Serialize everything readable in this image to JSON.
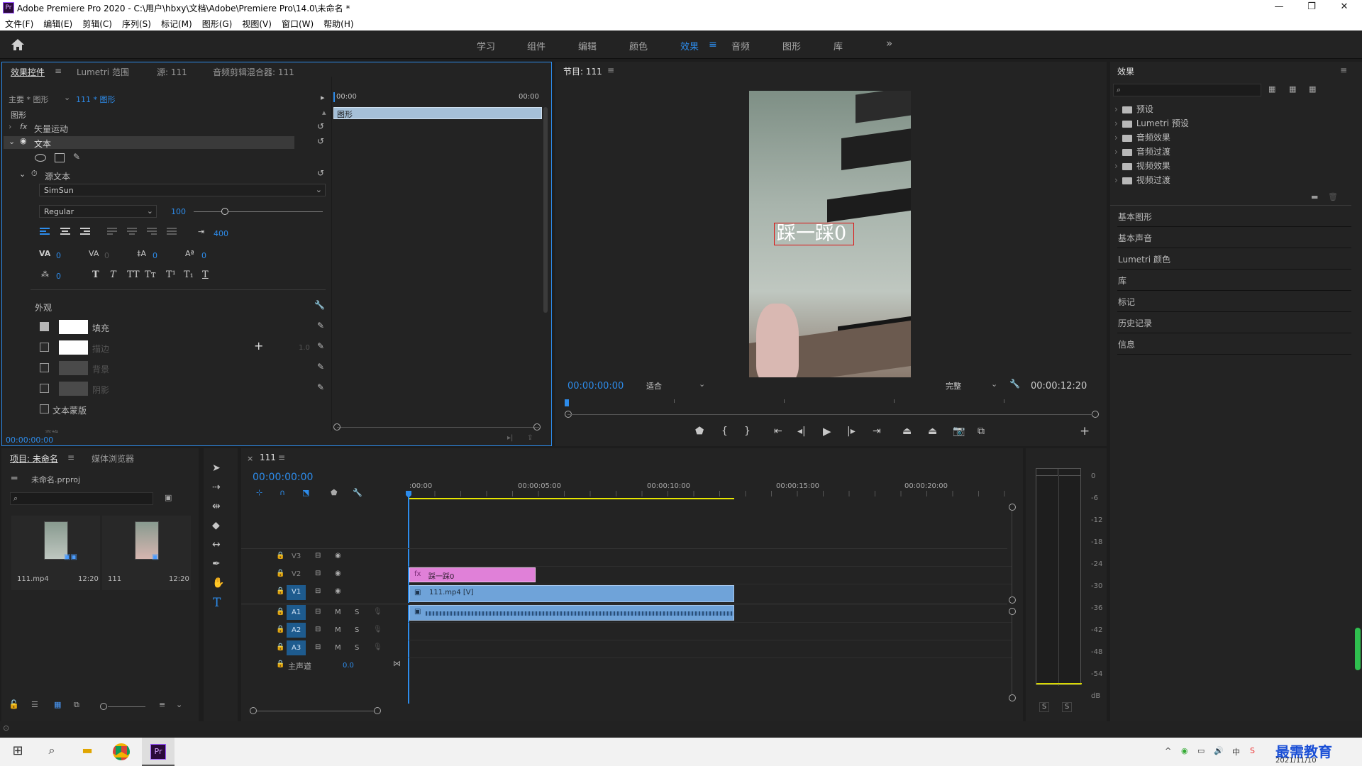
{
  "window": {
    "title": "Adobe Premiere Pro 2020 - C:\\用户\\hbxy\\文档\\Adobe\\Premiere Pro\\14.0\\未命名 *",
    "app_icon": "Pr",
    "minimize": "—",
    "maximize": "❐",
    "close": "✕"
  },
  "menu": [
    "文件(F)",
    "编辑(E)",
    "剪辑(C)",
    "序列(S)",
    "标记(M)",
    "图形(G)",
    "视图(V)",
    "窗口(W)",
    "帮助(H)"
  ],
  "workspaces": {
    "tabs": [
      "学习",
      "组件",
      "编辑",
      "颜色",
      "效果",
      "音频",
      "图形",
      "库"
    ],
    "active": "效果",
    "more": "»"
  },
  "effect_controls": {
    "tabs": [
      "效果控件",
      "Lumetri 范围",
      "源: 111",
      "音频剪辑混合器: 111"
    ],
    "master_label": "主要 * 图形",
    "clip_label": "111 * 图形",
    "ruler_start": "00:00",
    "ruler_end": "00:00",
    "bar_label": "图形",
    "section": "图形",
    "vector_motion": "矢量运动",
    "text_layer": "文本",
    "source_text": "源文本",
    "font": "SimSun",
    "style": "Regular",
    "font_size": "100",
    "font_size_slider": 0.24,
    "tracking_value": "400",
    "kerning": "0",
    "tracking2": "0",
    "leading": "0",
    "baseline": "0",
    "tsume": "0",
    "text_style_buttons": [
      "T",
      "T",
      "TT",
      "Tт",
      "T¹",
      "T₁",
      "T"
    ],
    "appearance": "外观",
    "fill": "填充",
    "stroke": "描边",
    "stroke_width": "1.0",
    "background": "背景",
    "shadow": "阴影",
    "text_mask": "文本蒙版",
    "more": "变换",
    "timecode": "00:00:00:00",
    "colors": {
      "fill": "#ffffff",
      "stroke": "#ffffff",
      "background": "#4a4a4a",
      "shadow": "#4a4a4a"
    }
  },
  "program": {
    "title": "节目: 111",
    "overlay_text": "踩一踩0",
    "timecode": "00:00:00:00",
    "fit": "适合",
    "quality": "完整",
    "duration": "00:00:12:20",
    "playhead": 0.0
  },
  "effects_panel": {
    "title": "效果",
    "items": [
      "预设",
      "Lumetri 预设",
      "音频效果",
      "音频过渡",
      "视频效果",
      "视频过渡"
    ],
    "sections": [
      "基本图形",
      "基本声音",
      "Lumetri 颜色",
      "库",
      "标记",
      "历史记录",
      "信息"
    ]
  },
  "project": {
    "tabs": [
      "项目: 未命名",
      "媒体浏览器"
    ],
    "file": "未命名.prproj",
    "items": [
      {
        "name": "111.mp4",
        "duration": "12:20"
      },
      {
        "name": "111",
        "duration": "12:20"
      }
    ]
  },
  "timeline": {
    "tab_close": "×",
    "tab": "111",
    "timecode": "00:00:00:00",
    "ruler": [
      ":00:00",
      "00:00:05:00",
      "00:00:10:00",
      "00:00:15:00",
      "00:00:20:00"
    ],
    "tracks_video": [
      "V3",
      "V2",
      "V1"
    ],
    "tracks_audio": [
      "A1",
      "A2",
      "A3"
    ],
    "master": "主声道",
    "master_value": "0.0",
    "clip_graphic": "踩一踩0",
    "clip_video": "111.mp4 [V]",
    "colors": {
      "graphic_clip": "#e080d8",
      "video_clip": "#6fa3d9",
      "audio_clip": "#6fa3d9",
      "work_area": "#e6e600"
    }
  },
  "meter": {
    "scale": [
      "0",
      "-6",
      "-12",
      "-18",
      "-24",
      "-30",
      "-36",
      "-42",
      "-48",
      "-54",
      "dB"
    ],
    "solo": [
      "S",
      "S"
    ]
  },
  "taskbar": {
    "time": "最需教育",
    "date": "2021/11/10",
    "ime": "中"
  }
}
